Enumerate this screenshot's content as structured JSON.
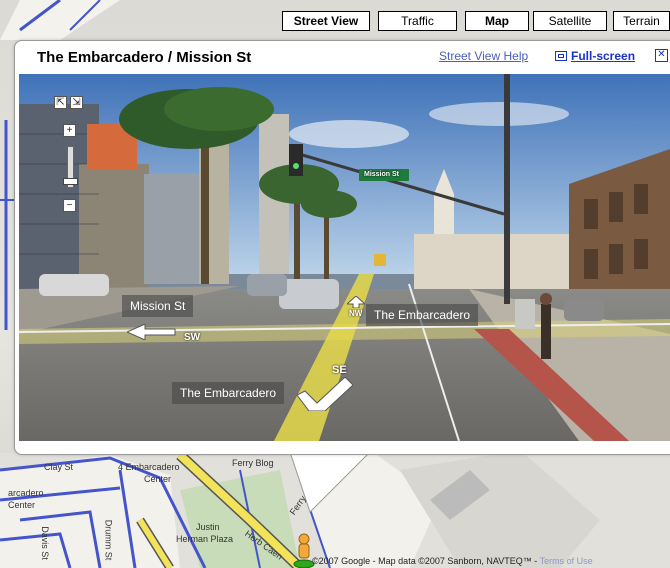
{
  "map_types": [
    {
      "label": "Street View",
      "active": true
    },
    {
      "label": "Traffic",
      "active": false
    },
    {
      "label": "Map",
      "active": true
    },
    {
      "label": "Satellite",
      "active": false
    },
    {
      "label": "Terrain",
      "active": false
    }
  ],
  "bubble": {
    "title": "The Embarcadero / Mission St",
    "help_link": "Street View Help",
    "fullscreen_link": "Full-screen",
    "close_symbol": "✕"
  },
  "panorama": {
    "signs": {
      "street_sign": "Mission St"
    },
    "labels": {
      "mission": "Mission St",
      "embarcadero_nw": "The Embarcadero",
      "embarcadero_se": "The Embarcadero"
    },
    "directions": {
      "sw": "SW",
      "nw": "NW",
      "se": "SE"
    },
    "controls": {
      "zoom_in": "+",
      "zoom_out": "−"
    }
  },
  "map_labels": {
    "clay_st": "Clay St",
    "embarcadero_center_1": "4 Embarcadero",
    "embarcadero_center_2": "Center",
    "ferry_blog": "Ferry Blog",
    "left_1": "arcadero",
    "left_2": "Center",
    "ferry_plaza": "Ferry Plaza",
    "justin_1": "Justin",
    "justin_2": "Herman Plaza",
    "herb_caen": "Herb Caen",
    "drumm": "Drumm St",
    "davis": "Davis St"
  },
  "copyright": {
    "text": "©2007 Google - Map data ©2007 Sanborn, NAVTEQ™ - ",
    "terms": "Terms of Use"
  }
}
